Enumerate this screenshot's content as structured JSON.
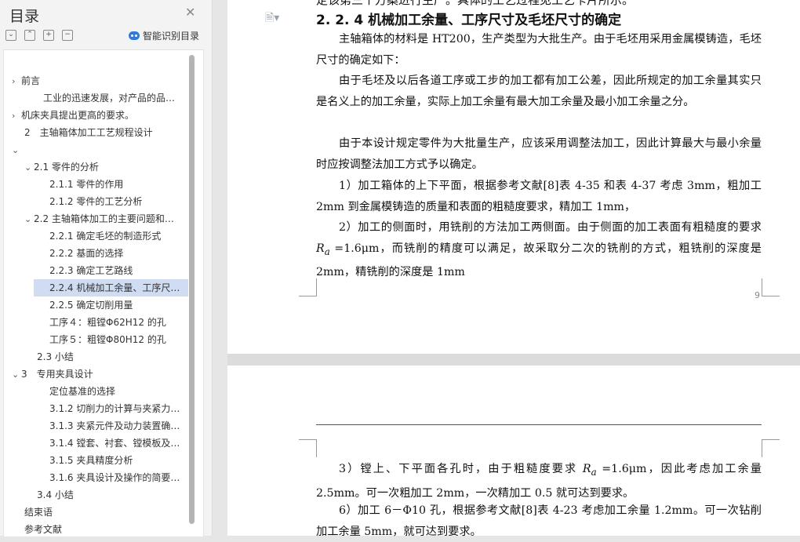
{
  "sidebar": {
    "title": "目录",
    "smart_label": "智能识别目录",
    "items": [
      {
        "label": "前言",
        "caret": "›"
      },
      {
        "label": "工业的迅速发展，对产品的品…",
        "caret": ""
      },
      {
        "label": "机床夹具提出更高的要求。",
        "caret": "›"
      },
      {
        "label": "2　主轴箱体加工工艺规程设计",
        "caret": ""
      },
      {
        "label": "",
        "caret": "⌄"
      },
      {
        "label": "2.1 零件的分析",
        "caret": "⌄"
      },
      {
        "label": "2.1.1 零件的作用",
        "caret": ""
      },
      {
        "label": "2.1.2 零件的工艺分析",
        "caret": ""
      },
      {
        "label": "2.2 主轴箱体加工的主要问题和…",
        "caret": "⌄"
      },
      {
        "label": "2.2.1 确定毛坯的制造形式",
        "caret": ""
      },
      {
        "label": "2.2.2 基面的选择",
        "caret": ""
      },
      {
        "label": "2.2.3 确定工艺路线",
        "caret": ""
      },
      {
        "label": "2.2.4 机械加工余量、工序尺…",
        "caret": ""
      },
      {
        "label": "2.2.5 确定切削用量",
        "caret": ""
      },
      {
        "label": "工序４：粗镗Φ62H12 的孔",
        "caret": ""
      },
      {
        "label": "工序５：粗镗Φ80H12 的孔",
        "caret": ""
      },
      {
        "label": "2.3 小结",
        "caret": ""
      },
      {
        "label": "3　专用夹具设计",
        "caret": "⌄"
      },
      {
        "label": "定位基准的选择",
        "caret": ""
      },
      {
        "label": "3.1.2 切削力的计算与夹紧力…",
        "caret": ""
      },
      {
        "label": "3.1.3 夹紧元件及动力装置确…",
        "caret": ""
      },
      {
        "label": "3.1.4 镗套、衬套、镗模板及…",
        "caret": ""
      },
      {
        "label": "3.1.5 夹具精度分析",
        "caret": ""
      },
      {
        "label": "3.1.6 夹具设计及操作的简要…",
        "caret": ""
      },
      {
        "label": "3.4 小结",
        "caret": ""
      },
      {
        "label": "结束语",
        "caret": ""
      },
      {
        "label": "参考文献",
        "caret": ""
      }
    ]
  },
  "doc": {
    "top_cut": "定该第三个方案进行生产。具体的工艺过程见工艺卡片所示。",
    "heading": "2. 2. 4 机械加工余量、工序尺寸及毛坯尺寸的确定",
    "p1": "主轴箱体的材料是 HT200，生产类型为大批生产。由于毛坯用采用金属模铸造，毛坯尺寸的确定如下：",
    "p2": "由于毛坯及以后各道工序或工步的加工都有加工公差，因此所规定的加工余量其实只是名义上的加工余量，实际上加工余量有最大加工余量及最小加工余量之分。",
    "p3": "由于本设计规定零件为大批量生产，应该采用调整法加工，因此计算最大与最小余量时应按调整法加工方式予以确定。",
    "p4": "1）加工箱体的上下平面，根据参考文献[8]表 4-35 和表 4-37 考虑 3mm，粗加工 2mm 到金属模铸造的质量和表面的粗糙度要求，精加工 1mm，",
    "p5a": "2）加工的侧面时，用铣削的方法加工两侧面。由于侧面的加工表面有粗糙度的要求 ",
    "ra": "R",
    "ra_sub": "a",
    "p5b": " =1.6μm，而铣削的精度可以满足，故采取分二次的铣削的方式，粗铣削的深度是 2mm，精铣削的深度是 1mm",
    "page_num": "9",
    "p6a": "3）镗上、下平面各孔时，由于粗糙度要求 ",
    "p6b": " =1.6μm，因此考虑加工余量 2.5mm。可一次粗加工 2mm，一次精加工 0.5 就可达到要求。",
    "p7": "6）加工 6－Φ10 孔，根据参考文献[8]表 4-23 考虑加工余量 1.2mm。可一次钻削加工余量 5mm，就可达到要求。"
  }
}
